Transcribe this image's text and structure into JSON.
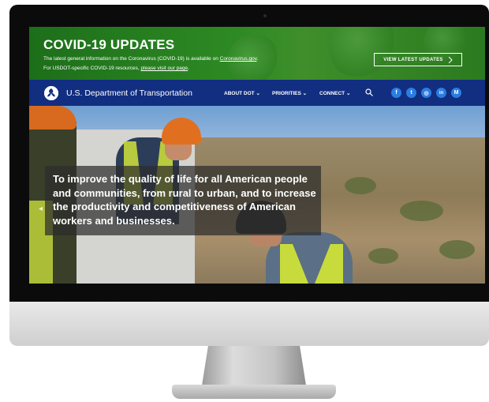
{
  "banner": {
    "title": "COVID-19 UPDATES",
    "line1_text": "The latest general information on the Coronavirus (COVID-19) is available on ",
    "line1_link": "Coronavirus.gov",
    "line1_end": ".",
    "line2_text": "For USDOT-specific COVID-19 resources, ",
    "line2_link": "please visit our page",
    "line2_end": ".",
    "button_label": "VIEW LATEST UPDATES",
    "button_icon": "chevron-right-icon",
    "color": "#2d8a23"
  },
  "nav": {
    "site_name": "U.S. Department of Transportation",
    "menu": [
      {
        "label": "ABOUT DOT ⌄"
      },
      {
        "label": "PRIORITIES ⌄"
      },
      {
        "label": "CONNECT ⌄"
      }
    ],
    "search_icon": "search-icon",
    "social": [
      {
        "name": "facebook-icon",
        "glyph": "f"
      },
      {
        "name": "twitter-icon",
        "glyph": "t"
      },
      {
        "name": "instagram-icon",
        "glyph": "◎"
      },
      {
        "name": "linkedin-icon",
        "glyph": "in"
      },
      {
        "name": "medium-icon",
        "glyph": "M"
      }
    ],
    "color": "#112e81"
  },
  "hero": {
    "caption": "To improve the quality of life for all American people and communities, from rural to urban, and to increase the productivity and competitiveness of American workers and businesses."
  }
}
